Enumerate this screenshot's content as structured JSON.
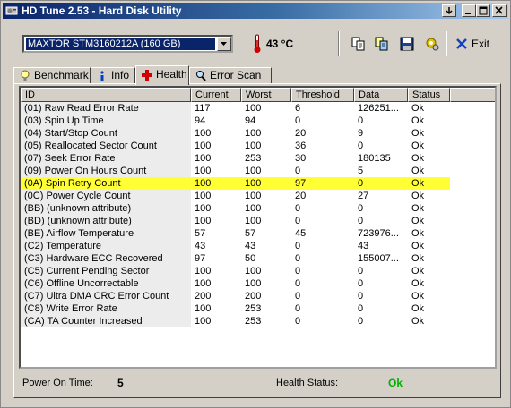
{
  "window": {
    "title": "HD Tune 2.53 - Hard Disk Utility"
  },
  "toolbar": {
    "drive": "MAXTOR STM3160212A (160 GB)",
    "temperature": "43 °C",
    "exit_label": "Exit"
  },
  "tabs": [
    {
      "label": "Benchmark",
      "icon": "benchmark-icon"
    },
    {
      "label": "Info",
      "icon": "info-icon"
    },
    {
      "label": "Health",
      "icon": "health-cross-icon",
      "active": true
    },
    {
      "label": "Error Scan",
      "icon": "magnifier-icon"
    }
  ],
  "table": {
    "columns": [
      "ID",
      "Current",
      "Worst",
      "Threshold",
      "Data",
      "Status"
    ],
    "highlight_color": "#ffff33",
    "rows": [
      {
        "id": "(01) Raw Read Error Rate",
        "current": "117",
        "worst": "100",
        "threshold": "6",
        "data": "126251...",
        "status": "Ok"
      },
      {
        "id": "(03) Spin Up Time",
        "current": "94",
        "worst": "94",
        "threshold": "0",
        "data": "0",
        "status": "Ok"
      },
      {
        "id": "(04) Start/Stop Count",
        "current": "100",
        "worst": "100",
        "threshold": "20",
        "data": "9",
        "status": "Ok"
      },
      {
        "id": "(05) Reallocated Sector Count",
        "current": "100",
        "worst": "100",
        "threshold": "36",
        "data": "0",
        "status": "Ok"
      },
      {
        "id": "(07) Seek Error Rate",
        "current": "100",
        "worst": "253",
        "threshold": "30",
        "data": "180135",
        "status": "Ok"
      },
      {
        "id": "(09) Power On Hours Count",
        "current": "100",
        "worst": "100",
        "threshold": "0",
        "data": "5",
        "status": "Ok"
      },
      {
        "id": "(0A) Spin Retry Count",
        "current": "100",
        "worst": "100",
        "threshold": "97",
        "data": "0",
        "status": "Ok",
        "highlight": true
      },
      {
        "id": "(0C) Power Cycle Count",
        "current": "100",
        "worst": "100",
        "threshold": "20",
        "data": "27",
        "status": "Ok"
      },
      {
        "id": "(BB) (unknown attribute)",
        "current": "100",
        "worst": "100",
        "threshold": "0",
        "data": "0",
        "status": "Ok"
      },
      {
        "id": "(BD) (unknown attribute)",
        "current": "100",
        "worst": "100",
        "threshold": "0",
        "data": "0",
        "status": "Ok"
      },
      {
        "id": "(BE) Airflow Temperature",
        "current": "57",
        "worst": "57",
        "threshold": "45",
        "data": "723976...",
        "status": "Ok"
      },
      {
        "id": "(C2) Temperature",
        "current": "43",
        "worst": "43",
        "threshold": "0",
        "data": "43",
        "status": "Ok"
      },
      {
        "id": "(C3) Hardware ECC Recovered",
        "current": "97",
        "worst": "50",
        "threshold": "0",
        "data": "155007...",
        "status": "Ok"
      },
      {
        "id": "(C5) Current Pending Sector",
        "current": "100",
        "worst": "100",
        "threshold": "0",
        "data": "0",
        "status": "Ok"
      },
      {
        "id": "(C6) Offline Uncorrectable",
        "current": "100",
        "worst": "100",
        "threshold": "0",
        "data": "0",
        "status": "Ok"
      },
      {
        "id": "(C7) Ultra DMA CRC Error Count",
        "current": "200",
        "worst": "200",
        "threshold": "0",
        "data": "0",
        "status": "Ok"
      },
      {
        "id": "(C8) Write Error Rate",
        "current": "100",
        "worst": "253",
        "threshold": "0",
        "data": "0",
        "status": "Ok"
      },
      {
        "id": "(CA) TA Counter Increased",
        "current": "100",
        "worst": "253",
        "threshold": "0",
        "data": "0",
        "status": "Ok"
      }
    ]
  },
  "status": {
    "power_on_label": "Power On Time:",
    "power_on_value": "5",
    "health_label": "Health Status:",
    "health_value": "Ok",
    "health_color": "#00b000"
  }
}
